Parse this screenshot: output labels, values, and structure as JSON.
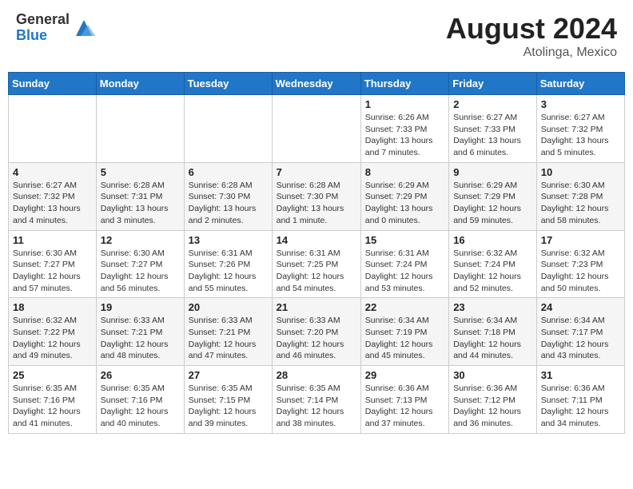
{
  "header": {
    "logo_general": "General",
    "logo_blue": "Blue",
    "month_year": "August 2024",
    "location": "Atolinga, Mexico"
  },
  "weekdays": [
    "Sunday",
    "Monday",
    "Tuesday",
    "Wednesday",
    "Thursday",
    "Friday",
    "Saturday"
  ],
  "weeks": [
    [
      {
        "day": "",
        "info": ""
      },
      {
        "day": "",
        "info": ""
      },
      {
        "day": "",
        "info": ""
      },
      {
        "day": "",
        "info": ""
      },
      {
        "day": "1",
        "info": "Sunrise: 6:26 AM\nSunset: 7:33 PM\nDaylight: 13 hours and 7 minutes."
      },
      {
        "day": "2",
        "info": "Sunrise: 6:27 AM\nSunset: 7:33 PM\nDaylight: 13 hours and 6 minutes."
      },
      {
        "day": "3",
        "info": "Sunrise: 6:27 AM\nSunset: 7:32 PM\nDaylight: 13 hours and 5 minutes."
      }
    ],
    [
      {
        "day": "4",
        "info": "Sunrise: 6:27 AM\nSunset: 7:32 PM\nDaylight: 13 hours and 4 minutes."
      },
      {
        "day": "5",
        "info": "Sunrise: 6:28 AM\nSunset: 7:31 PM\nDaylight: 13 hours and 3 minutes."
      },
      {
        "day": "6",
        "info": "Sunrise: 6:28 AM\nSunset: 7:30 PM\nDaylight: 13 hours and 2 minutes."
      },
      {
        "day": "7",
        "info": "Sunrise: 6:28 AM\nSunset: 7:30 PM\nDaylight: 13 hours and 1 minute."
      },
      {
        "day": "8",
        "info": "Sunrise: 6:29 AM\nSunset: 7:29 PM\nDaylight: 13 hours and 0 minutes."
      },
      {
        "day": "9",
        "info": "Sunrise: 6:29 AM\nSunset: 7:29 PM\nDaylight: 12 hours and 59 minutes."
      },
      {
        "day": "10",
        "info": "Sunrise: 6:30 AM\nSunset: 7:28 PM\nDaylight: 12 hours and 58 minutes."
      }
    ],
    [
      {
        "day": "11",
        "info": "Sunrise: 6:30 AM\nSunset: 7:27 PM\nDaylight: 12 hours and 57 minutes."
      },
      {
        "day": "12",
        "info": "Sunrise: 6:30 AM\nSunset: 7:27 PM\nDaylight: 12 hours and 56 minutes."
      },
      {
        "day": "13",
        "info": "Sunrise: 6:31 AM\nSunset: 7:26 PM\nDaylight: 12 hours and 55 minutes."
      },
      {
        "day": "14",
        "info": "Sunrise: 6:31 AM\nSunset: 7:25 PM\nDaylight: 12 hours and 54 minutes."
      },
      {
        "day": "15",
        "info": "Sunrise: 6:31 AM\nSunset: 7:24 PM\nDaylight: 12 hours and 53 minutes."
      },
      {
        "day": "16",
        "info": "Sunrise: 6:32 AM\nSunset: 7:24 PM\nDaylight: 12 hours and 52 minutes."
      },
      {
        "day": "17",
        "info": "Sunrise: 6:32 AM\nSunset: 7:23 PM\nDaylight: 12 hours and 50 minutes."
      }
    ],
    [
      {
        "day": "18",
        "info": "Sunrise: 6:32 AM\nSunset: 7:22 PM\nDaylight: 12 hours and 49 minutes."
      },
      {
        "day": "19",
        "info": "Sunrise: 6:33 AM\nSunset: 7:21 PM\nDaylight: 12 hours and 48 minutes."
      },
      {
        "day": "20",
        "info": "Sunrise: 6:33 AM\nSunset: 7:21 PM\nDaylight: 12 hours and 47 minutes."
      },
      {
        "day": "21",
        "info": "Sunrise: 6:33 AM\nSunset: 7:20 PM\nDaylight: 12 hours and 46 minutes."
      },
      {
        "day": "22",
        "info": "Sunrise: 6:34 AM\nSunset: 7:19 PM\nDaylight: 12 hours and 45 minutes."
      },
      {
        "day": "23",
        "info": "Sunrise: 6:34 AM\nSunset: 7:18 PM\nDaylight: 12 hours and 44 minutes."
      },
      {
        "day": "24",
        "info": "Sunrise: 6:34 AM\nSunset: 7:17 PM\nDaylight: 12 hours and 43 minutes."
      }
    ],
    [
      {
        "day": "25",
        "info": "Sunrise: 6:35 AM\nSunset: 7:16 PM\nDaylight: 12 hours and 41 minutes."
      },
      {
        "day": "26",
        "info": "Sunrise: 6:35 AM\nSunset: 7:16 PM\nDaylight: 12 hours and 40 minutes."
      },
      {
        "day": "27",
        "info": "Sunrise: 6:35 AM\nSunset: 7:15 PM\nDaylight: 12 hours and 39 minutes."
      },
      {
        "day": "28",
        "info": "Sunrise: 6:35 AM\nSunset: 7:14 PM\nDaylight: 12 hours and 38 minutes."
      },
      {
        "day": "29",
        "info": "Sunrise: 6:36 AM\nSunset: 7:13 PM\nDaylight: 12 hours and 37 minutes."
      },
      {
        "day": "30",
        "info": "Sunrise: 6:36 AM\nSunset: 7:12 PM\nDaylight: 12 hours and 36 minutes."
      },
      {
        "day": "31",
        "info": "Sunrise: 6:36 AM\nSunset: 7:11 PM\nDaylight: 12 hours and 34 minutes."
      }
    ]
  ]
}
